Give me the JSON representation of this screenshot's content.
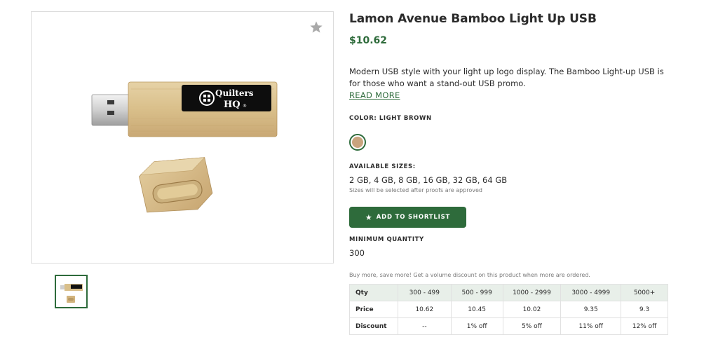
{
  "product": {
    "title": "Lamon Avenue Bamboo Light Up USB",
    "price": "$10.62",
    "description": "Modern USB style with your light up logo display. The Bamboo Light-up USB is for those who want a stand-out USB promo.",
    "read_more": "READ MORE",
    "logo_text": {
      "line1": "Quilters",
      "line2": "HQ",
      "mark": "®"
    }
  },
  "color": {
    "label": "COLOR: LIGHT BROWN",
    "swatch_hex": "#c9a47e"
  },
  "sizes": {
    "label": "AVAILABLE SIZES:",
    "value": "2 GB, 4 GB, 8 GB, 16 GB, 32 GB, 64 GB",
    "note": "Sizes will be selected after proofs are approved"
  },
  "shortlist_button": {
    "icon": "star-icon",
    "label": "ADD TO SHORTLIST"
  },
  "minimum_quantity": {
    "label": "MINIMUM QUANTITY",
    "value": "300"
  },
  "discount_note": "Buy more, save more! Get a volume discount on this product when more are ordered.",
  "pricing_table": {
    "rows": [
      [
        "Qty",
        "300 - 499",
        "500 - 999",
        "1000 - 2999",
        "3000 - 4999",
        "5000+"
      ],
      [
        "Price",
        "10.62",
        "10.45",
        "10.02",
        "9.35",
        "9.3"
      ],
      [
        "Discount",
        "--",
        "1% off",
        "5% off",
        "11% off",
        "12% off"
      ]
    ]
  },
  "colors": {
    "accent": "#2e6b3b",
    "table_header_bg": "#e8efe9",
    "favorite_star": "#a9a9a9"
  },
  "icons": {
    "favorite": "star-icon",
    "shortlist": "star-icon"
  }
}
